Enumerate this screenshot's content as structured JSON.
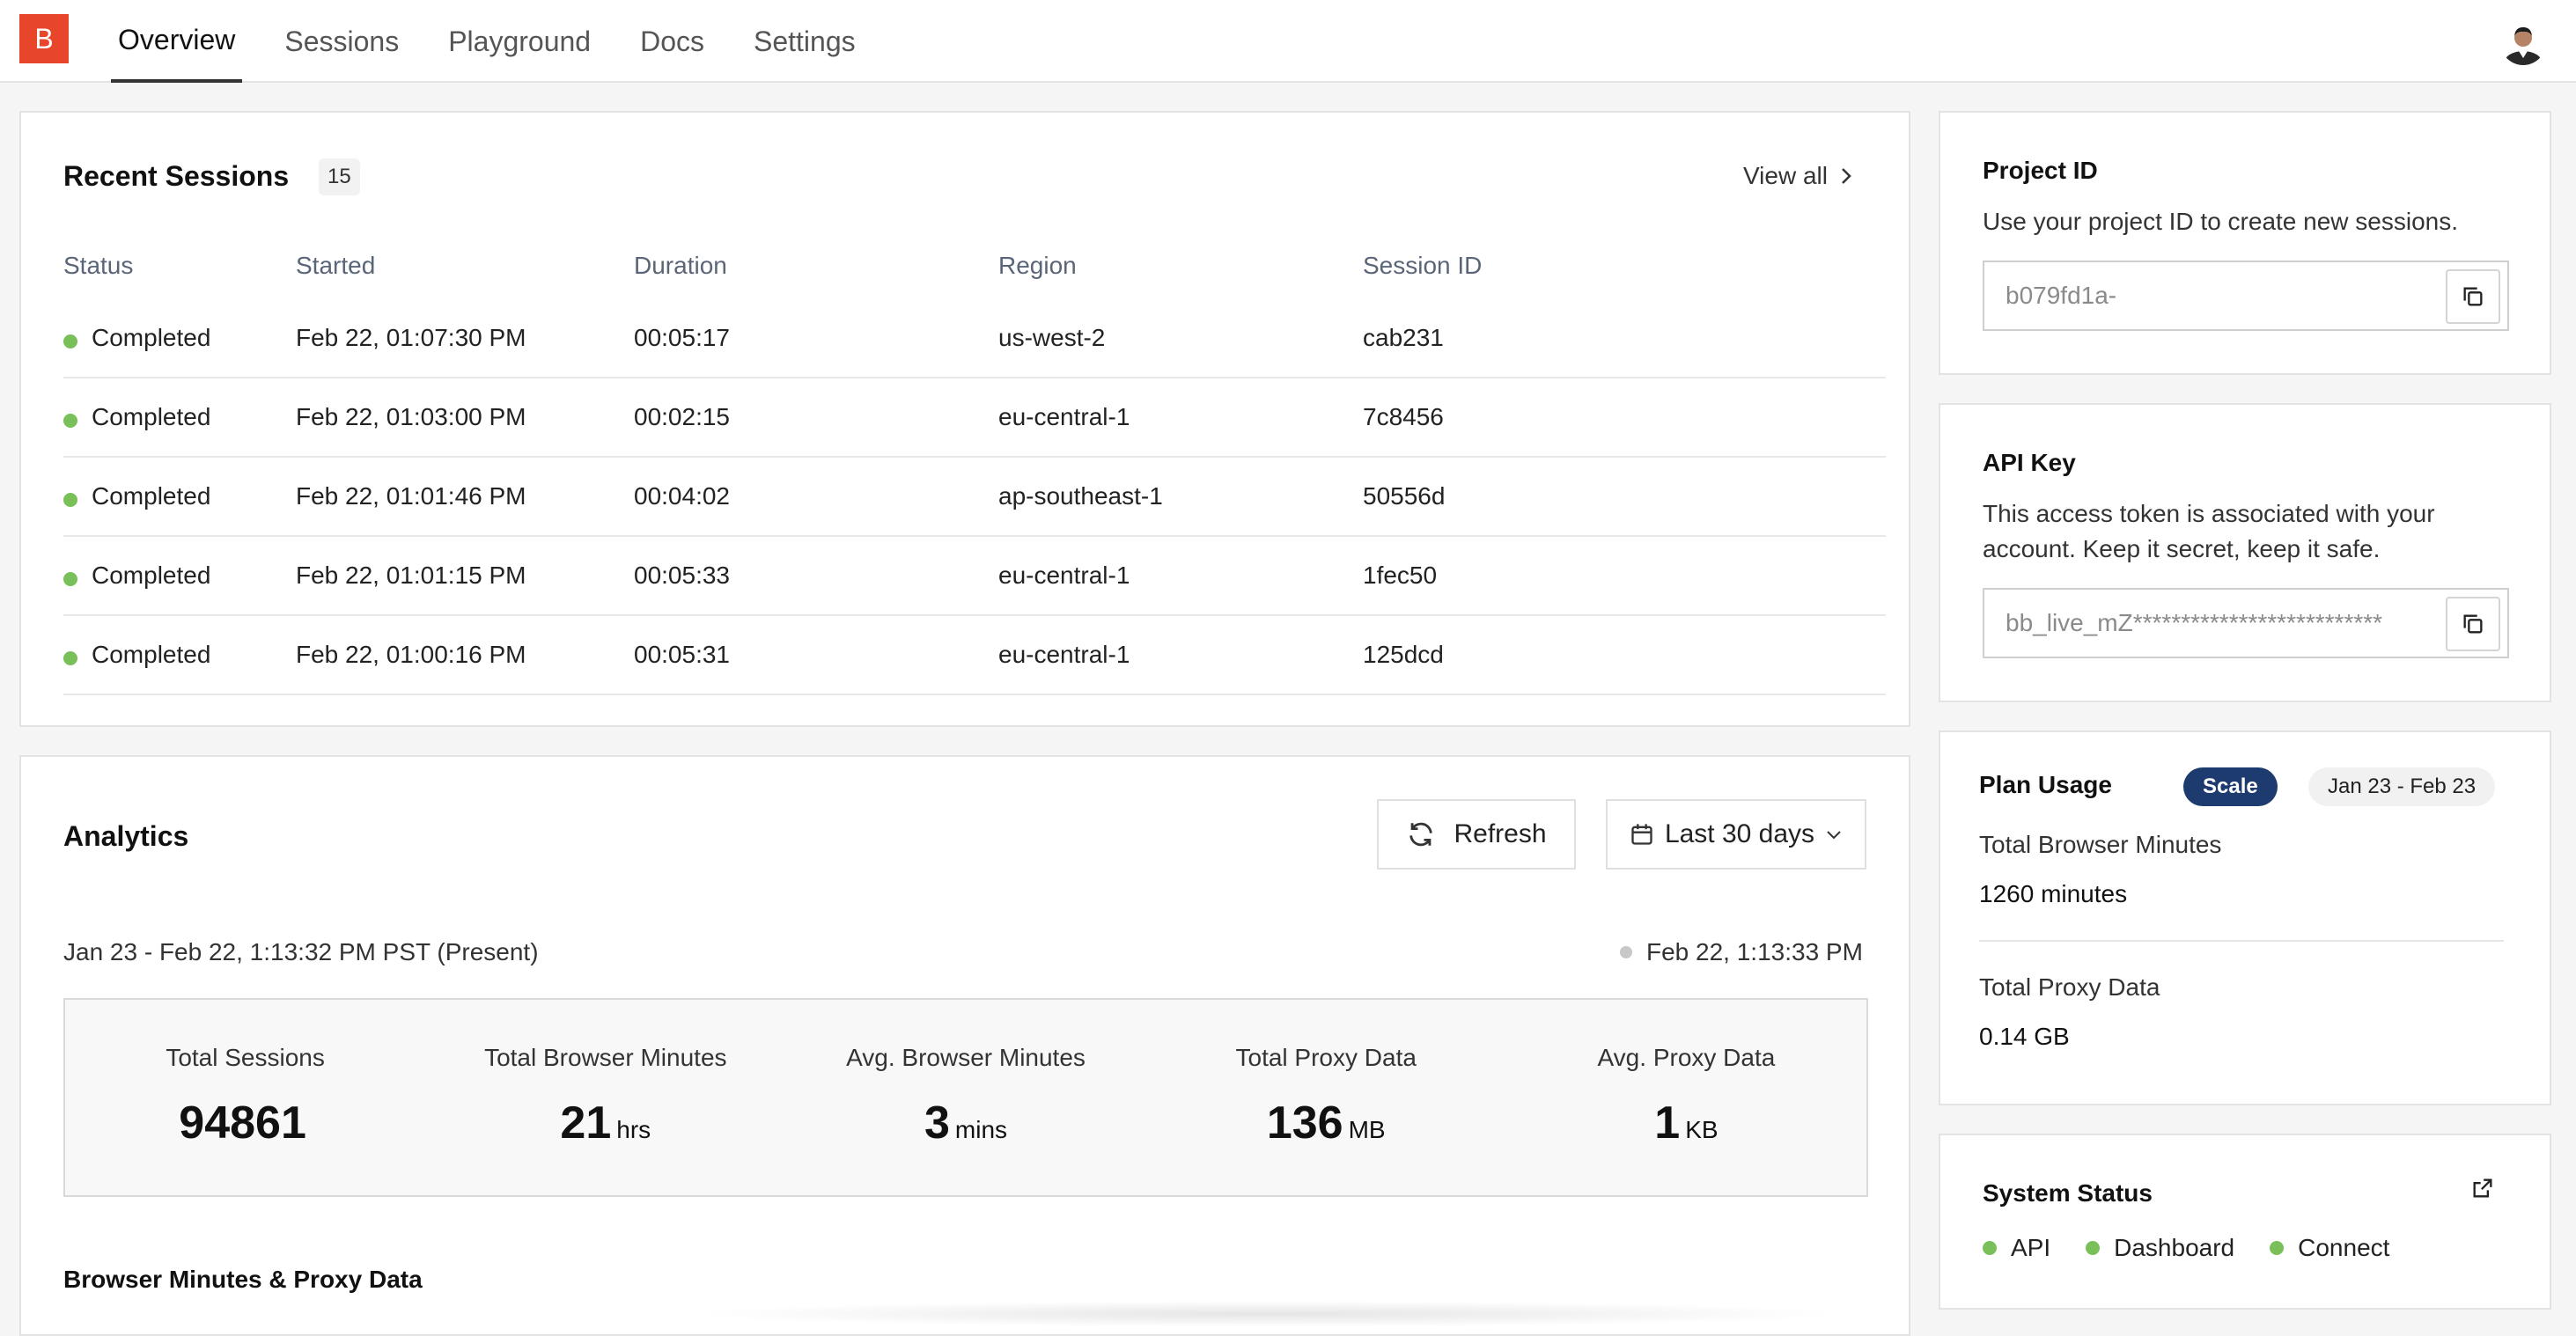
{
  "nav": {
    "logo": "B",
    "tabs": [
      "Overview",
      "Sessions",
      "Playground",
      "Docs",
      "Settings"
    ],
    "active_tab": "Overview"
  },
  "sessions": {
    "title": "Recent Sessions",
    "count": "15",
    "view_all": "View all",
    "columns": [
      "Status",
      "Started",
      "Duration",
      "Region",
      "Session ID"
    ],
    "rows": [
      {
        "status": "Completed",
        "started": "Feb 22, 01:07:30 PM",
        "duration": "00:05:17",
        "region": "us-west-2",
        "id": "cab231"
      },
      {
        "status": "Completed",
        "started": "Feb 22, 01:03:00 PM",
        "duration": "00:02:15",
        "region": "eu-central-1",
        "id": "7c8456"
      },
      {
        "status": "Completed",
        "started": "Feb 22, 01:01:46 PM",
        "duration": "00:04:02",
        "region": "ap-southeast-1",
        "id": "50556d"
      },
      {
        "status": "Completed",
        "started": "Feb 22, 01:01:15 PM",
        "duration": "00:05:33",
        "region": "eu-central-1",
        "id": "1fec50"
      },
      {
        "status": "Completed",
        "started": "Feb 22, 01:00:16 PM",
        "duration": "00:05:31",
        "region": "eu-central-1",
        "id": "125dcd"
      }
    ]
  },
  "analytics": {
    "title": "Analytics",
    "refresh_label": "Refresh",
    "range_label": "Last 30 days",
    "range_text": "Jan 23 - Feb 22, 1:13:32 PM PST (Present)",
    "as_of": "Feb 22, 1:13:33 PM",
    "stats": [
      {
        "label": "Total Sessions",
        "value": "94861",
        "unit": ""
      },
      {
        "label": "Total Browser Minutes",
        "value": "21",
        "unit": "hrs"
      },
      {
        "label": "Avg. Browser Minutes",
        "value": "3",
        "unit": "mins"
      },
      {
        "label": "Total Proxy Data",
        "value": "136",
        "unit": "MB"
      },
      {
        "label": "Avg. Proxy Data",
        "value": "1",
        "unit": "KB"
      }
    ],
    "subsection_title": "Browser Minutes & Proxy Data"
  },
  "project": {
    "title": "Project ID",
    "description": "Use your project ID to create new sessions.",
    "value": "b079fd1a-"
  },
  "api": {
    "title": "API Key",
    "description": "This access token is associated with your account. Keep it secret, keep it safe.",
    "value": "bb_live_mZ**************************"
  },
  "plan": {
    "title": "Plan Usage",
    "tier": "Scale",
    "period": "Jan 23 - Feb 23",
    "browser_minutes_label": "Total Browser Minutes",
    "browser_minutes_value": "1260 minutes",
    "proxy_label": "Total Proxy Data",
    "proxy_value": "0.14 GB"
  },
  "system_status": {
    "title": "System Status",
    "items": [
      "API",
      "Dashboard",
      "Connect"
    ]
  },
  "colors": {
    "brand": "#e8462a",
    "status_ok": "#7ac05a",
    "plan_badge": "#1d3b6e"
  }
}
